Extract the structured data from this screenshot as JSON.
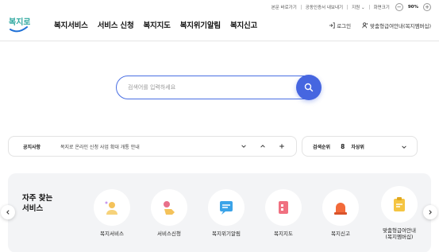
{
  "utility": {
    "items": [
      "본문 바로가기",
      "공동인증서 내보내기",
      "지원 ⌄",
      "화면크기"
    ],
    "zoom_minus": "−",
    "zoom_value": "90%",
    "zoom_plus": "+"
  },
  "header": {
    "logo_text": "복지로",
    "nav": [
      "복지서비스",
      "서비스 신청",
      "복지지도",
      "복지위기알림",
      "복지신고"
    ],
    "login": "로그인",
    "guide": "맞춤형급여안내(복지멤버십)"
  },
  "search": {
    "placeholder": "검색어를 입력하세요"
  },
  "notice": {
    "label": "공지사항",
    "text": "복지로 온라인 신청 사업 확대 개통 안내"
  },
  "rank": {
    "label": "검색순위",
    "number": "8",
    "keyword": "차상위"
  },
  "frequent": {
    "title_line1": "자주 찾는",
    "title_line2": "서비스",
    "items": [
      {
        "label": "복지서비스"
      },
      {
        "label": "서비스신청"
      },
      {
        "label": "복지위기알림"
      },
      {
        "label": "복지지도"
      },
      {
        "label": "복지신고"
      },
      {
        "label": "맞춤형급여안내\n(복지멤버십)"
      }
    ]
  },
  "colors": {
    "accent": "#4666e0",
    "panel_bg": "#f3f4f6"
  }
}
